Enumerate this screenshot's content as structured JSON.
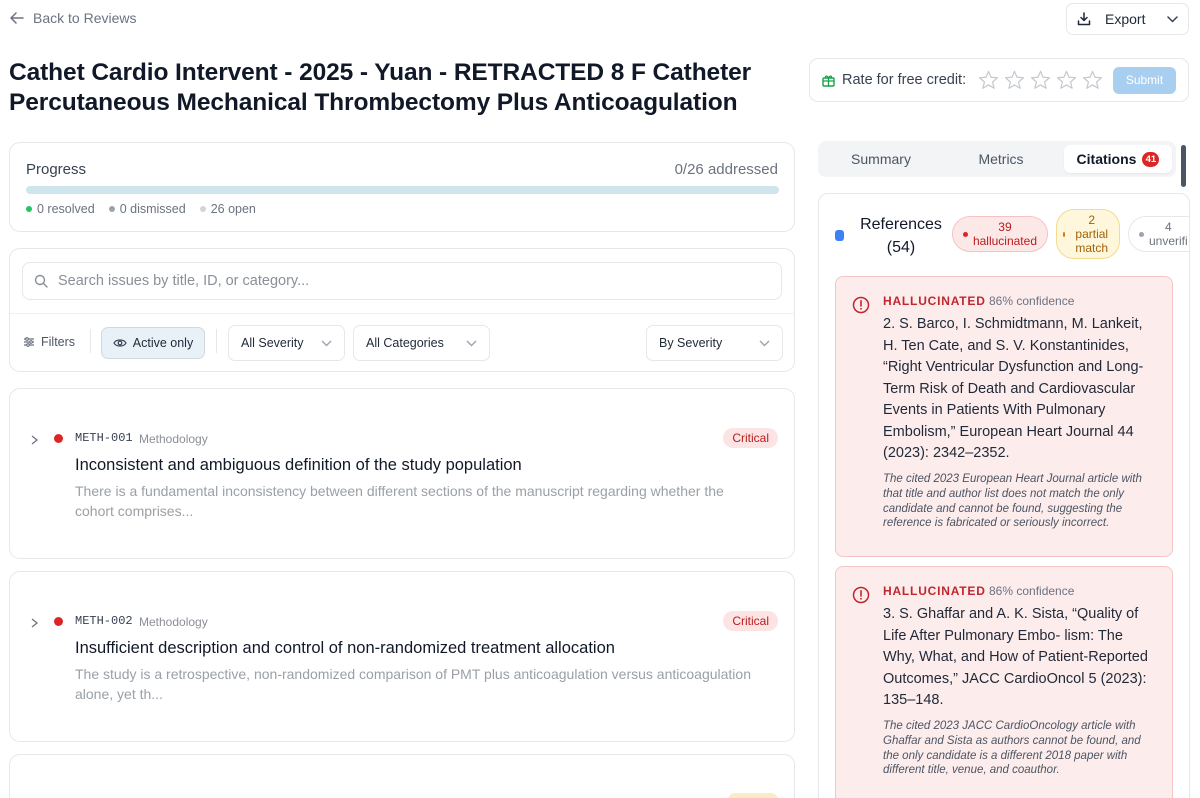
{
  "header": {
    "back_label": "Back to Reviews",
    "export_label": "Export",
    "title": "Cathet Cardio Intervent - 2025 - Yuan - RETRACTED 8 F Catheter Percutaneous Mechanical Thrombectomy Plus Anticoagulation"
  },
  "rating": {
    "label": "Rate for free credit:",
    "stars": 0,
    "max_stars": 5,
    "submit_label": "Submit"
  },
  "progress": {
    "title": "Progress",
    "count_text": "0/26 addressed",
    "fraction": 0,
    "resolved": "0 resolved",
    "dismissed": "0 dismissed",
    "open": "26 open",
    "colors": {
      "resolved": "#22c55e",
      "dismissed": "#9ca3af",
      "open": "#d1d5db",
      "bar": "#cfe5ee"
    }
  },
  "filters": {
    "search_placeholder": "Search issues by title, ID, or category...",
    "filters_label": "Filters",
    "active_only_label": "Active only",
    "severity_value": "All Severity",
    "category_value": "All Categories",
    "sort_value": "By Severity"
  },
  "issues": [
    {
      "id": "METH-001",
      "category": "Methodology",
      "severity": "Critical",
      "title": "Inconsistent and ambiguous definition of the study population",
      "description": "There is a fundamental inconsistency between different sections of the manuscript regarding whether the cohort comprises..."
    },
    {
      "id": "METH-002",
      "category": "Methodology",
      "severity": "Critical",
      "title": "Insufficient description and control of non-randomized treatment allocation",
      "description": "The study is a retrospective, non-randomized comparison of PMT plus anticoagulation versus anticoagulation alone, yet th..."
    }
  ],
  "right_panel": {
    "tabs": [
      {
        "label": "Summary",
        "active": false
      },
      {
        "label": "Metrics",
        "active": false
      },
      {
        "label": "Citations",
        "active": true,
        "badge": "41"
      }
    ],
    "references_label": "References (54)",
    "pills": {
      "hallucinated_count": "39",
      "hallucinated_label": "hallucinated",
      "partial_count": "2",
      "partial_label": "partial match",
      "unverified_count": "4",
      "unverified_label": "unverifi"
    },
    "citations": [
      {
        "kind": "HALLUCINATED",
        "confidence": "86% confidence",
        "text": "2. S. Barco, I. Schmidtmann, M. Lankeit, H. Ten Cate, and S. V. Konstantinides, “Right Ventricular Dysfunction and Long-Term Risk of Death and Cardiovascular Events in Patients With Pulmonary Embolism,” European Heart Journal 44 (2023): 2342–2352.",
        "note": "The cited 2023 European Heart Journal article with that title and author list does not match the only candidate and cannot be found, suggesting the reference is fabricated or seriously incorrect."
      },
      {
        "kind": "HALLUCINATED",
        "confidence": "86% confidence",
        "text": "3. S. Ghaffar and A. K. Sista, “Quality of Life After Pulmonary Embo- lism: The Why, What, and How of Patient-Reported Outcomes,” JACC CardioOncol 5 (2023): 135–148.",
        "note": "The cited 2023 JACC CardioOncology article with Ghaffar and Sista as authors cannot be found, and the only candidate is a different 2018 paper with different title, venue, and coauthor."
      }
    ]
  }
}
